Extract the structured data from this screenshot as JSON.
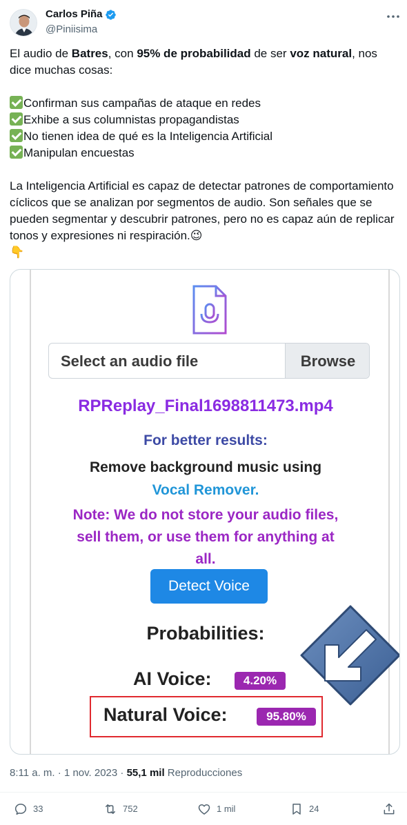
{
  "author": {
    "name": "Carlos Piña",
    "handle": "@Piniisima",
    "verified_color": "#1d9bf0"
  },
  "tweet": {
    "intro_pre": "El audio de ",
    "intro_bold1": "Batres",
    "intro_mid1": ", con ",
    "intro_bold2": "95% de probabilidad",
    "intro_mid2": " de ser ",
    "intro_bold3": "voz natural",
    "intro_post": ", nos dice muchas cosas:",
    "checklist": [
      "Confirman sus campañas de ataque en redes",
      "Exhibe a sus columnistas propagandistas",
      "No tienen idea de qué es la Inteligencia Artificial",
      "Manipulan encuestas"
    ],
    "paragraph": "La Inteligencia Artificial es capaz de detectar patrones de comportamiento cíclicos que se analizan por segmentos de audio. Son señales que se pueden segmentar y descubrir patrones, pero no es capaz aún de replicar tonos y expresiones ni respiración.",
    "wink_emoji": "😉",
    "pointing_emoji": "👇"
  },
  "media": {
    "file_input_label": "Select an audio file",
    "browse_label": "Browse",
    "filename": "RPReplay_Final1698811473.mp4",
    "better_results": "For better results:",
    "remove_music": "Remove background music using",
    "vocal_remover": "Vocal Remover.",
    "note": "Note: We do not store your audio files, sell them, or use them for anything at all.",
    "detect_button": "Detect Voice",
    "probabilities_title": "Probabilities:",
    "ai_voice_label": "AI Voice:",
    "ai_voice_value": "4.20%",
    "natural_voice_label": "Natural Voice:",
    "natural_voice_value": "95.80%",
    "accent_purple": "#9b27b0",
    "button_blue": "#1e88e5",
    "highlight_red": "#e0282e"
  },
  "meta": {
    "time": "8:11 a. m.",
    "separator": "·",
    "date": "1 nov. 2023",
    "views_count": "55,1 mil",
    "views_label": "Reproducciones"
  },
  "actions": {
    "replies": "33",
    "reposts": "752",
    "likes": "1 mil",
    "bookmarks": "24"
  }
}
